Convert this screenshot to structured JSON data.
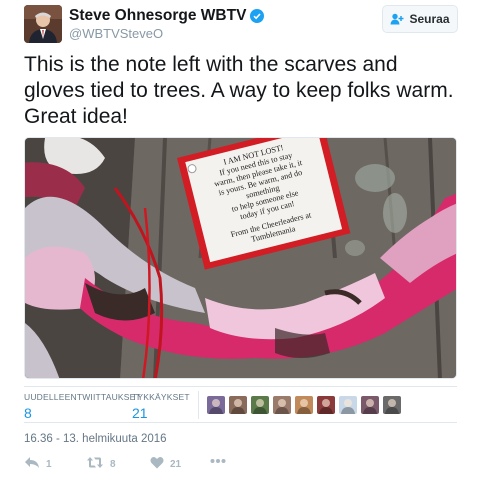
{
  "tweet": {
    "author_name": "Steve Ohnesorge WBTV",
    "author_handle": "@WBTVSteveO",
    "follow_label": "Seuraa",
    "text": "This is the note left with the scarves and gloves tied to trees. A way to keep folks warm. Great idea!",
    "photo_note": {
      "lines": [
        "I AM NOT LOST!",
        "If you need this to stay",
        "warm, then please take it, it",
        "is yours. Be warm, and do",
        "something",
        "to help someone else",
        "today if you can!",
        "",
        "From the Cheerleaders at",
        "Tumblemania"
      ]
    },
    "stats": {
      "retweets_label": "UUDELLEENTWIITTAUKSET",
      "retweets_value": "8",
      "likes_label": "TYKKÄYKSET",
      "likes_value": "21"
    },
    "timestamp": "16.36 - 13. helmikuuta 2016",
    "actions": {
      "reply_count": "1",
      "retweet_count": "8",
      "like_count": "21"
    },
    "liker_colors": [
      "#7a6a9a",
      "#8a6a5a",
      "#5a7a4a",
      "#9a7a6a",
      "#c08a5a",
      "#8a3a3a",
      "#c8d8e8",
      "#7a5a6a",
      "#6a6a6a"
    ],
    "colors": {
      "accent": "#1b95e0",
      "verified": "#1da1f2",
      "muted": "#657786",
      "action_gray": "#aab8c2"
    }
  }
}
